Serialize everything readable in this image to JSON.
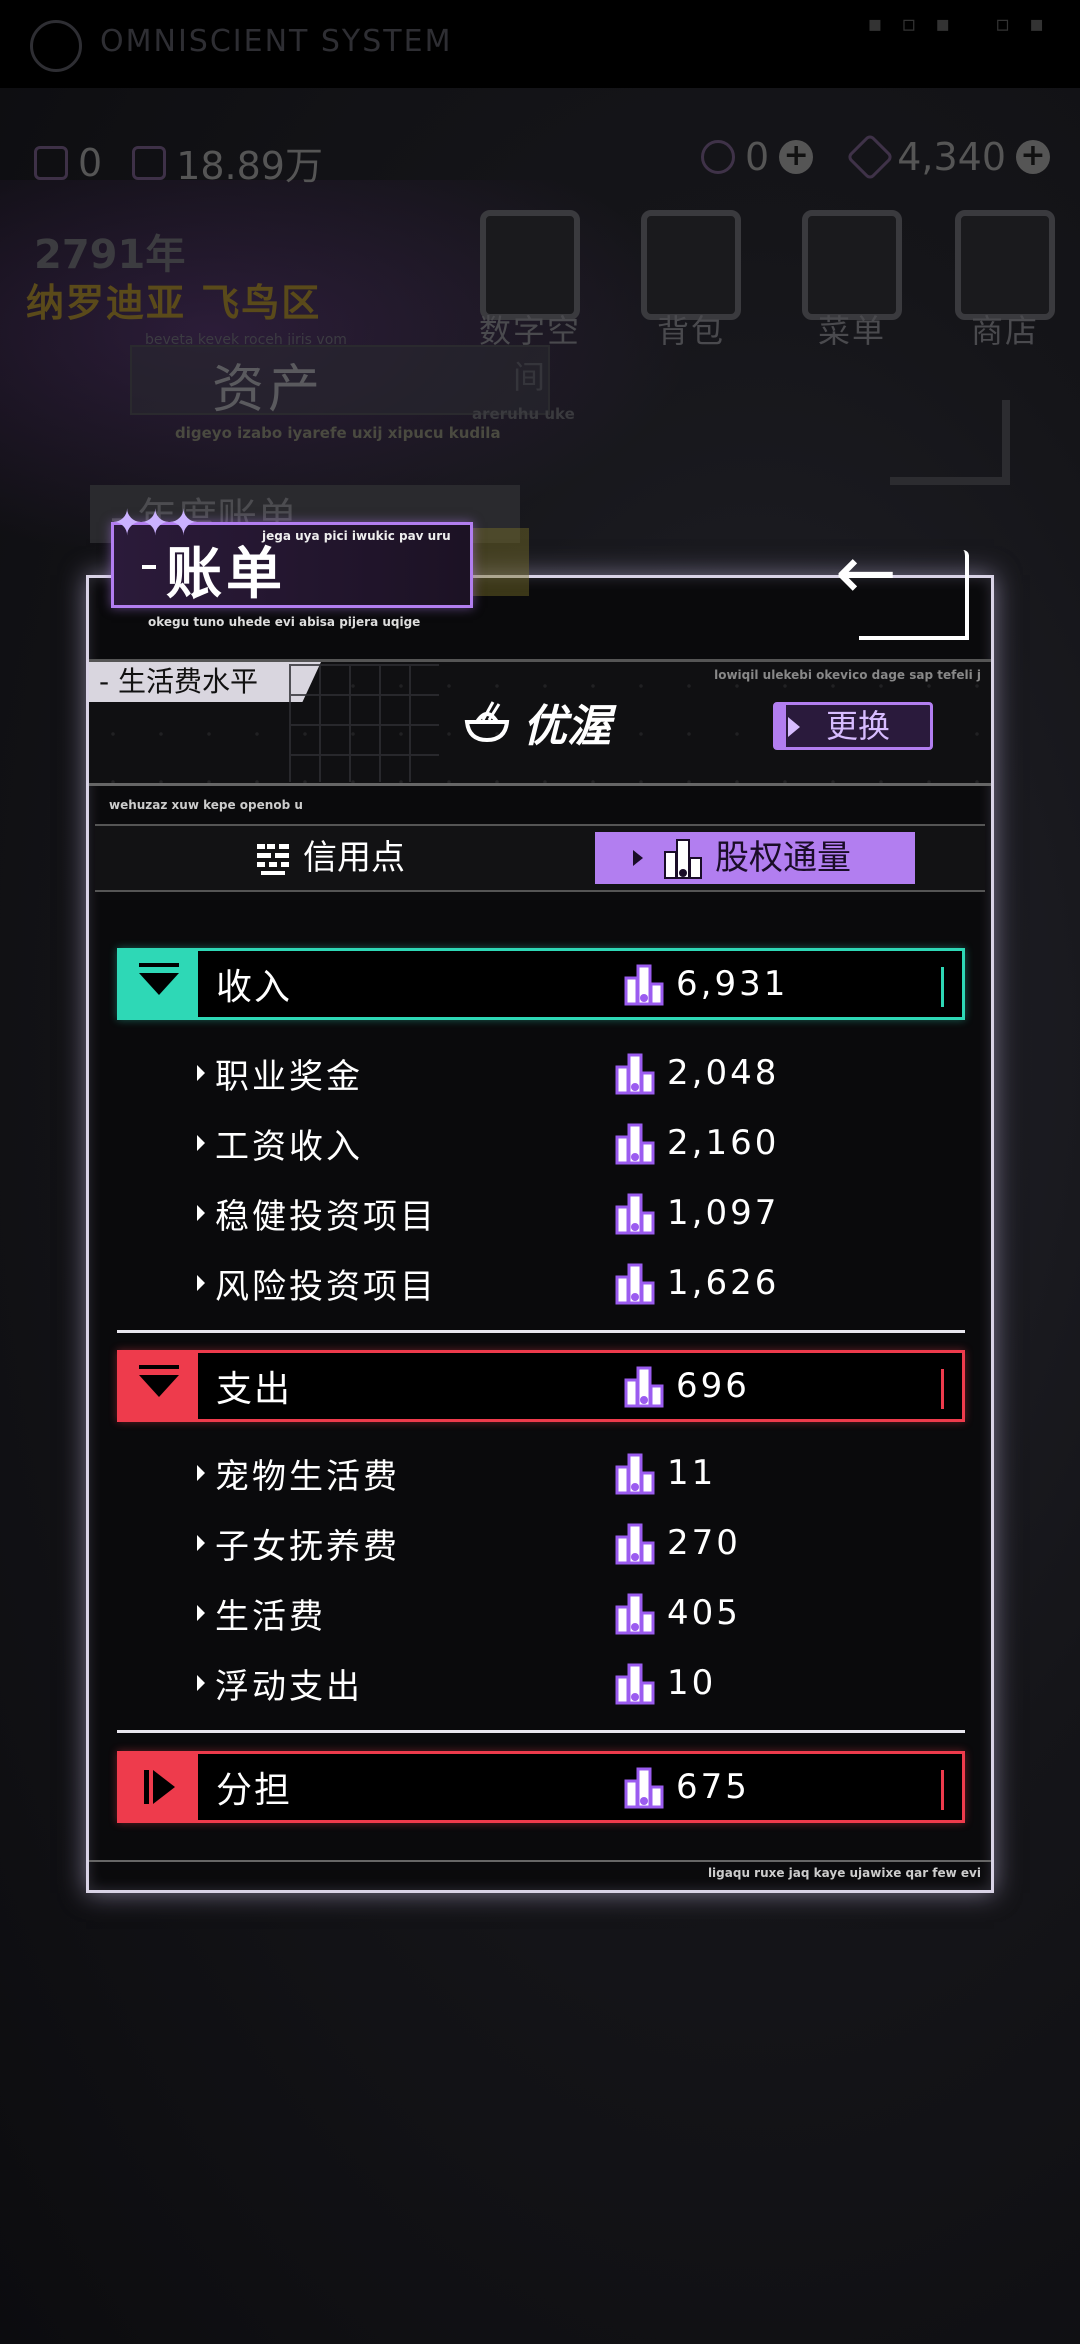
{
  "system": {
    "title": "OMNISCIENT  SYSTEM"
  },
  "resources": {
    "credit": "0",
    "equity": "18.89万",
    "gem_a": "0",
    "gem_b": "4,340"
  },
  "world": {
    "year": "2791年",
    "location": "纳罗迪亚 飞鸟区"
  },
  "nav": [
    {
      "label": "数字空间",
      "icon": "digital-space-icon"
    },
    {
      "label": "背包",
      "icon": "backpack-icon"
    },
    {
      "label": "菜单",
      "icon": "menu-icon"
    },
    {
      "label": "商店",
      "icon": "shop-icon"
    }
  ],
  "background": {
    "asset_title": "资产",
    "asset_sub1": "beveta kevek roceh jiris vom",
    "asset_sub2": "digeyo izabo iyarefe uxij xipucu kudila",
    "asset_sub3": "areruhu uke",
    "annual_bill": "- 年度账单"
  },
  "dialog": {
    "title": "账单",
    "title_sub_top": "jega uya pici iwukic pav uru",
    "title_sub_bottom": "okegu tuno uhede evi abisa pijera uqige",
    "level_tag": "- 生活费水平",
    "level_name": "优渥",
    "level_code": "lowiqil ulekebi okevico dage sap tefeli j",
    "change_label": "更换",
    "code_line": "wehuzaz xuw kepe openob u",
    "footer_code": "ligaqu ruxe jaq kaye ujawixe qar few evi",
    "tabs": [
      {
        "label": "信用点",
        "active": false
      },
      {
        "label": "股权通量",
        "active": true
      }
    ],
    "income": {
      "label": "收入",
      "value": "6,931",
      "items": [
        {
          "label": "职业奖金",
          "value": "2,048"
        },
        {
          "label": "工资收入",
          "value": "2,160"
        },
        {
          "label": "稳健投资项目",
          "value": "1,097"
        },
        {
          "label": "风险投资项目",
          "value": "1,626"
        }
      ]
    },
    "expense": {
      "label": "支出",
      "value": "696",
      "items": [
        {
          "label": "宠物生活费",
          "value": "11"
        },
        {
          "label": "子女抚养费",
          "value": "270"
        },
        {
          "label": "生活费",
          "value": "405"
        },
        {
          "label": "浮动支出",
          "value": "10"
        }
      ]
    },
    "share": {
      "label": "分担",
      "value": "675"
    }
  },
  "colors": {
    "accent": "#b27ef0",
    "income": "#2ed8b6",
    "expense": "#ee3b4c"
  }
}
